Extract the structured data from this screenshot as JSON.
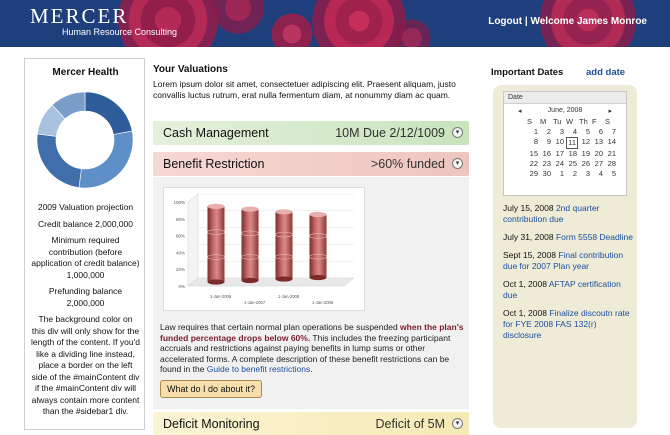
{
  "header": {
    "logo_title": "MERCER",
    "logo_subtitle": "Human Resource Consulting",
    "logout": "Logout",
    "separator": "|",
    "welcome": "Welcome James Monroe"
  },
  "sidebar": {
    "title": "Mercer Health",
    "lines": [
      "2009 Valuation projection",
      "Credit balance 2,000,000",
      "Minimum required contribution (before application of credit balance) 1,000,000",
      "Prefunding balance 2,000,000",
      "The background color on this div will only show for the length of the content. If you'd like a dividing line instead, place a border on the left side of the #mainContent div if the #mainContent div will always contain more content than the #sidebar1 div."
    ],
    "donut_segments": [
      {
        "value": 22,
        "color": "#2e5d99"
      },
      {
        "value": 30,
        "color": "#5f8fc9"
      },
      {
        "value": 25,
        "color": "#3f6eab"
      },
      {
        "value": 11,
        "color": "#a9c2e2"
      },
      {
        "value": 12,
        "color": "#7b9dc9"
      }
    ]
  },
  "main": {
    "title": "Your Valuations",
    "intro": "Lorem ipsum dolor sit amet, consectetuer adipiscing elit. Praesent aliquam, justo convallis luctus rutrum, erat nulla fermentum diam, at nonummy diam ac quam."
  },
  "bars": {
    "cash": {
      "label": "Cash Management",
      "value": "10M Due 2/12/1009"
    },
    "benefit": {
      "label": "Benefit Restriction",
      "value": ">60% funded"
    },
    "deficit": {
      "label": "Deficit Monitoring",
      "value": "Deficit of 5M"
    }
  },
  "benefit_panel": {
    "text_before": "Law requires that certain normal plan operations be suspended ",
    "text_emph": "when the plan's funded percentage drops below 60%.",
    "text_mid": " This includes the freezing participant accruals and restrictions against paying benefits in lump sums or other accelerated forms. A complete description of these benefit restrictions can be found in the ",
    "text_link": "Guide to benefit restrictions",
    "text_end": ".",
    "button": "What do I do about it?"
  },
  "chart_data": {
    "type": "bar",
    "categories": [
      "1-Jan-2006",
      "1-Jan-2007",
      "1-Jan-2008",
      "1-Jan-2009"
    ],
    "values": [
      90,
      85,
      80,
      75
    ],
    "ylim": [
      0,
      100
    ],
    "yticks": [
      "0%",
      "20%",
      "40%",
      "60%",
      "80%",
      "100%"
    ],
    "bar_color": "#b45a5a"
  },
  "important_dates": {
    "title": "Important Dates",
    "add": "add date",
    "calendar": {
      "header": "Date",
      "prev": "◂",
      "next": "▸",
      "month": "June, 2008",
      "weekdays": [
        "S",
        "M",
        "Tu",
        "W",
        "Th",
        "F",
        "S"
      ],
      "days": [
        "1",
        "2",
        "3",
        "4",
        "5",
        "6",
        "7",
        "8",
        "9",
        "10",
        "11",
        "12",
        "13",
        "14",
        "15",
        "16",
        "17",
        "18",
        "19",
        "20",
        "21",
        "22",
        "23",
        "24",
        "25",
        "26",
        "27",
        "28",
        "29",
        "30",
        "1",
        "2",
        "3",
        "4",
        "5"
      ],
      "today": "11"
    },
    "items": [
      {
        "date": "July 15, 2008",
        "text": "2nd quarter contribution due"
      },
      {
        "date": "July 31, 2008",
        "text": "Form 5558 Deadline"
      },
      {
        "date": "Sept 15, 2008",
        "text": "Final contribution due for 2007 Plan year"
      },
      {
        "date": "Oct 1, 2008",
        "text": "AFTAP certification due"
      },
      {
        "date": "Oct 1, 2008",
        "text": "Finalize discoutn rate for FYE 2008 FAS 132(r) disclosure"
      }
    ]
  }
}
